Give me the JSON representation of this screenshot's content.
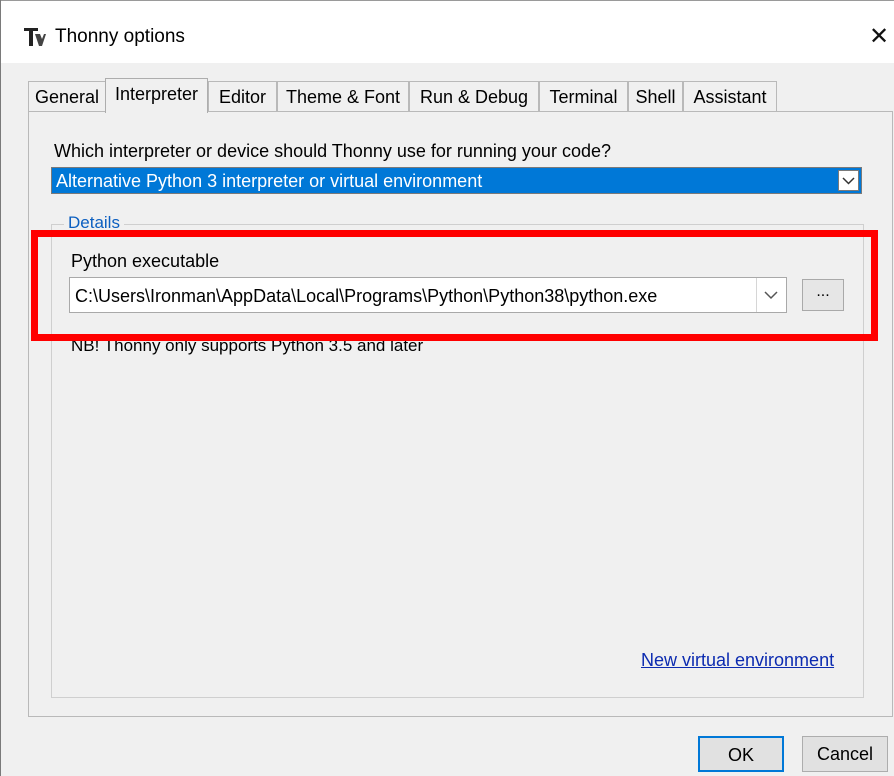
{
  "window": {
    "title": "Thonny options",
    "icon": "thonny-app-icon",
    "close_label": "✕"
  },
  "tabs": [
    {
      "label": "General",
      "active": false
    },
    {
      "label": "Interpreter",
      "active": true
    },
    {
      "label": "Editor",
      "active": false
    },
    {
      "label": "Theme & Font",
      "active": false
    },
    {
      "label": "Run & Debug",
      "active": false
    },
    {
      "label": "Terminal",
      "active": false
    },
    {
      "label": "Shell",
      "active": false
    },
    {
      "label": "Assistant",
      "active": false
    }
  ],
  "interpreter": {
    "question": "Which interpreter or device should Thonny use for running your code?",
    "selected": "Alternative Python 3 interpreter or virtual environment",
    "details_label": "Details",
    "python_executable_label": "Python executable",
    "python_executable_value": "C:\\Users\\Ironman\\AppData\\Local\\Programs\\Python\\Python38\\python.exe",
    "browse_label": "...",
    "note": "NB! Thonny only supports Python 3.5 and later",
    "new_venv_link": "New virtual environment"
  },
  "buttons": {
    "ok": "OK",
    "cancel": "Cancel"
  },
  "colors": {
    "accent": "#0078d7",
    "highlight": "#ff0000",
    "link": "#0c2bb0"
  }
}
